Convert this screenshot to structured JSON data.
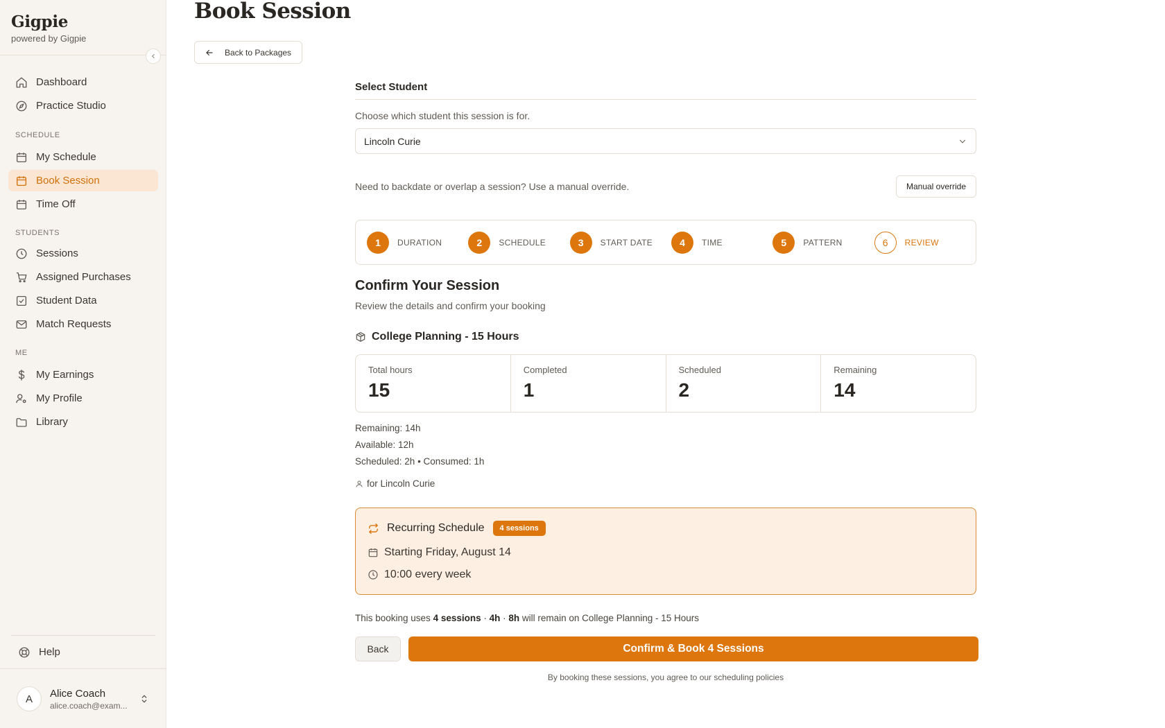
{
  "brand": {
    "name": "Gigpie",
    "subtitle": "powered by Gigpie"
  },
  "sidebar": {
    "top_items": [
      {
        "label": "Dashboard",
        "icon": "home-icon"
      },
      {
        "label": "Practice Studio",
        "icon": "compass-icon"
      }
    ],
    "sections": [
      {
        "title": "SCHEDULE",
        "items": [
          {
            "label": "My Schedule",
            "icon": "calendar-icon"
          },
          {
            "label": "Book Session",
            "icon": "calendar-icon",
            "active": true
          },
          {
            "label": "Time Off",
            "icon": "calendar-icon"
          }
        ]
      },
      {
        "title": "STUDENTS",
        "items": [
          {
            "label": "Sessions",
            "icon": "clock-icon"
          },
          {
            "label": "Assigned Purchases",
            "icon": "cart-icon"
          },
          {
            "label": "Student Data",
            "icon": "check-square-icon"
          },
          {
            "label": "Match Requests",
            "icon": "mail-icon"
          }
        ]
      },
      {
        "title": "ME",
        "items": [
          {
            "label": "My Earnings",
            "icon": "dollar-icon"
          },
          {
            "label": "My Profile",
            "icon": "user-cog-icon"
          },
          {
            "label": "Library",
            "icon": "folder-icon"
          }
        ]
      }
    ],
    "help_label": "Help",
    "user": {
      "initial": "A",
      "name": "Alice Coach",
      "email": "alice.coach@exam..."
    }
  },
  "page": {
    "title": "Book Session",
    "back_to_packages": "Back to Packages"
  },
  "student": {
    "heading": "Select Student",
    "description": "Choose which student this session is for.",
    "selected": "Lincoln Curie"
  },
  "override": {
    "text": "Need to backdate or overlap a session? Use a manual override.",
    "button": "Manual override"
  },
  "steps": [
    {
      "num": "1",
      "label": "DURATION",
      "state": "done"
    },
    {
      "num": "2",
      "label": "SCHEDULE",
      "state": "done"
    },
    {
      "num": "3",
      "label": "START DATE",
      "state": "done"
    },
    {
      "num": "4",
      "label": "TIME",
      "state": "done"
    },
    {
      "num": "5",
      "label": "PATTERN",
      "state": "done"
    },
    {
      "num": "6",
      "label": "REVIEW",
      "state": "current"
    }
  ],
  "confirm": {
    "title": "Confirm Your Session",
    "subtitle": "Review the details and confirm your booking"
  },
  "package": {
    "name": "College Planning - 15 Hours",
    "stats": [
      {
        "label": "Total hours",
        "value": "15"
      },
      {
        "label": "Completed",
        "value": "1"
      },
      {
        "label": "Scheduled",
        "value": "2"
      },
      {
        "label": "Remaining",
        "value": "14"
      }
    ],
    "remaining_line": "Remaining: 14h",
    "available_line": "Available: 12h",
    "scheduled_line": "Scheduled: 2h • Consumed: 1h",
    "for_line": "for Lincoln Curie"
  },
  "recurring": {
    "title": "Recurring Schedule",
    "badge": "4 sessions",
    "start": "Starting Friday, August 14",
    "time": "10:00 every week"
  },
  "summary": {
    "prefix": "This booking uses ",
    "sessions": "4 sessions",
    "sep1": " · ",
    "hours": "4h",
    "sep2": " · ",
    "remain": "8h",
    "suffix": " will remain on College Planning - 15 Hours"
  },
  "actions": {
    "back": "Back",
    "confirm": "Confirm & Book 4 Sessions",
    "footnote": "By booking these sessions, you agree to our scheduling policies"
  },
  "colors": {
    "accent": "#dc760d",
    "sidebar_bg": "#f7f4ef",
    "active_bg": "#fbe6d3"
  }
}
